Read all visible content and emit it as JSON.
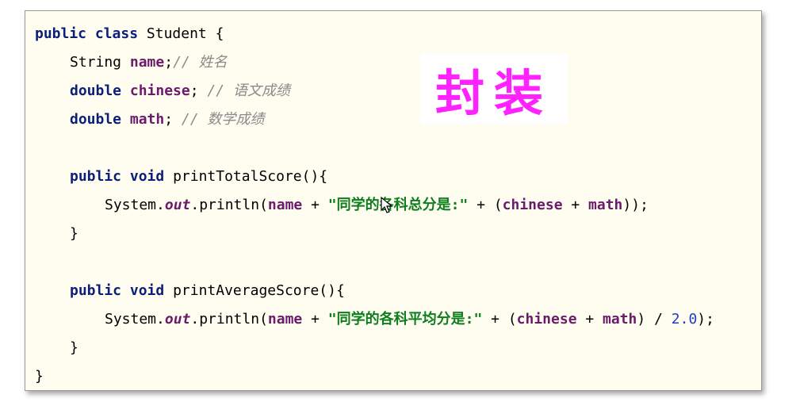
{
  "code": {
    "l1": {
      "kw1": "public",
      "kw2": "class",
      "cls": "Student",
      "brace": "{"
    },
    "l2": {
      "type": "String",
      "name": "name",
      "semi": ";",
      "comment": "// 姓名"
    },
    "l3": {
      "type": "double",
      "name": "chinese",
      "semi": ";",
      "comment": "// 语文成绩"
    },
    "l4": {
      "type": "double",
      "name": "math",
      "semi": ";",
      "comment": "// 数学成绩"
    },
    "l5": {
      "kw1": "public",
      "kw2": "void",
      "method": "printTotalScore(){"
    },
    "l6": {
      "sys": "System.",
      "out": "out",
      "println": ".println(",
      "name": "name",
      "plus1": " + ",
      "str": "\"同学的各科总分是:\"",
      "plus2": " + (",
      "chinese": "chinese",
      "plus3": " + ",
      "math": "math",
      "end": "));"
    },
    "l7": {
      "brace": "}"
    },
    "l8": {
      "kw1": "public",
      "kw2": "void",
      "method": "printAverageScore(){"
    },
    "l9": {
      "sys": "System.",
      "out": "out",
      "println": ".println(",
      "name": "name",
      "plus1": " + ",
      "str": "\"同学的各科平均分是:\"",
      "plus2": " + (",
      "chinese": "chinese",
      "plus3": " + ",
      "math": "math",
      "div": ") / ",
      "num": "2.0",
      "end": ");"
    },
    "l10": {
      "brace": "}"
    },
    "l11": {
      "brace": "}"
    }
  },
  "overlay": {
    "label": "封装",
    "color": "#ff22ff"
  }
}
